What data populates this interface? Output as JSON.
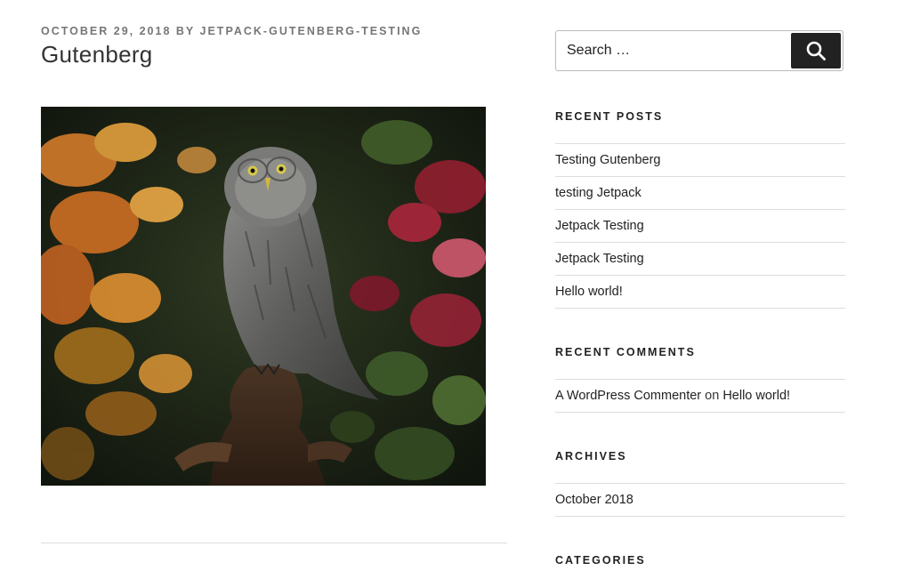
{
  "post": {
    "date": "OCTOBER 29, 2018",
    "by": "BY",
    "author": "JETPACK-GUTENBERG-TESTING",
    "title": "Gutenberg"
  },
  "search": {
    "placeholder": "Search …",
    "button_label": "Search"
  },
  "recent_posts": {
    "title": "RECENT POSTS",
    "items": [
      "Testing Gutenberg",
      "testing Jetpack",
      "Jetpack Testing",
      "Jetpack Testing",
      "Hello world!"
    ]
  },
  "recent_comments": {
    "title": "RECENT COMMENTS",
    "items": [
      {
        "author": "A WordPress Commenter",
        "on": "on",
        "post": "Hello world!"
      }
    ]
  },
  "archives": {
    "title": "ARCHIVES",
    "items": [
      "October 2018"
    ]
  },
  "categories": {
    "title": "CATEGORIES"
  }
}
